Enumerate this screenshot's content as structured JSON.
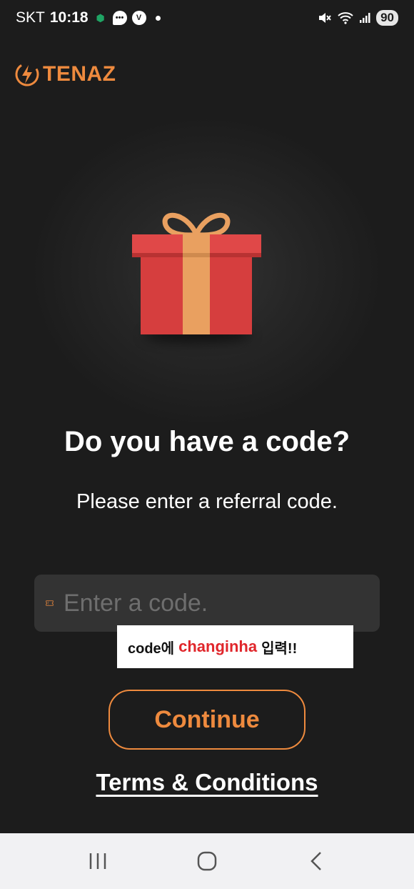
{
  "status_bar": {
    "carrier": "SKT",
    "time": "10:18",
    "battery": "90"
  },
  "logo": {
    "text": "TENAZ"
  },
  "main": {
    "title": "Do you have a code?",
    "subtitle": "Please enter a referral code.",
    "code_input": {
      "value": "",
      "placeholder": "Enter a code."
    },
    "continue_label": "Continue",
    "terms_label": "Terms & Conditions"
  },
  "annotation": {
    "prefix": "code에",
    "highlight": "changinha",
    "suffix": "입력!!"
  },
  "icons": {
    "ticket": "ticket-icon",
    "gift": "gift-illustration",
    "recents": "recent-apps-icon",
    "home": "home-icon",
    "back": "back-icon"
  },
  "colors": {
    "background": "#1c1c1c",
    "accent": "#ee8a3e",
    "field": "#333333",
    "gift_red": "#d63e3e",
    "ribbon": "#e9a060",
    "annotation_highlight": "#e0262b"
  }
}
